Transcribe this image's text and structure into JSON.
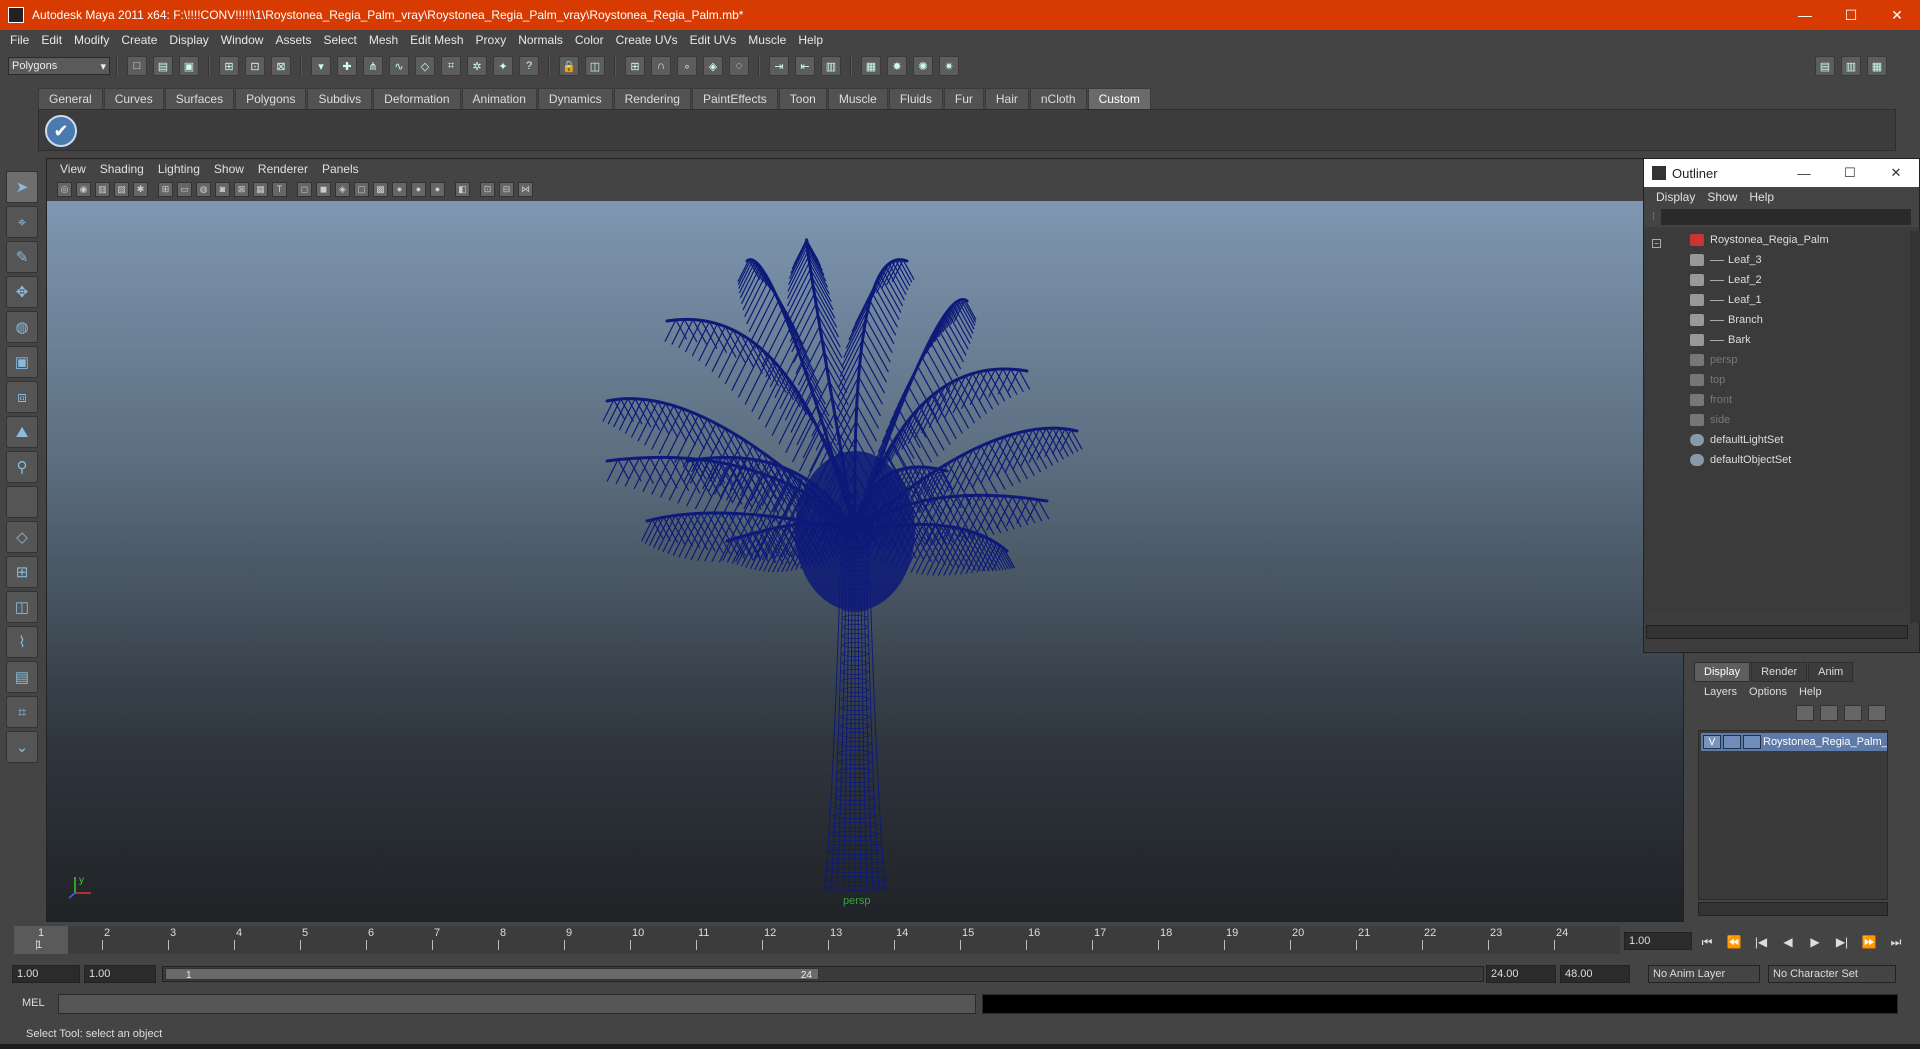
{
  "window": {
    "title": "Autodesk Maya 2011 x64: F:\\!!!!CONV!!!!!\\1\\Roystonea_Regia_Palm_vray\\Roystonea_Regia_Palm_vray\\Roystonea_Regia_Palm.mb*",
    "minimize": "—",
    "maximize": "☐",
    "close": "✕"
  },
  "menu": [
    "File",
    "Edit",
    "Modify",
    "Create",
    "Display",
    "Window",
    "Assets",
    "Select",
    "Mesh",
    "Edit Mesh",
    "Proxy",
    "Normals",
    "Color",
    "Create UVs",
    "Edit UVs",
    "Muscle",
    "Help"
  ],
  "statusline": {
    "mode": "Polygons",
    "mode_arrow": "▾"
  },
  "shelf": {
    "tabs": [
      "General",
      "Curves",
      "Surfaces",
      "Polygons",
      "Subdivs",
      "Deformation",
      "Animation",
      "Dynamics",
      "Rendering",
      "PaintEffects",
      "Toon",
      "Muscle",
      "Fluids",
      "Fur",
      "Hair",
      "nCloth",
      "Custom"
    ],
    "active_tab": "Custom",
    "button_glyph": "✔"
  },
  "viewport": {
    "menu": [
      "View",
      "Shading",
      "Lighting",
      "Show",
      "Renderer",
      "Panels"
    ],
    "camera": "persp",
    "mesh_color": "#0d1a78"
  },
  "outliner": {
    "title": "Outliner",
    "min": "—",
    "max": "☐",
    "close": "✕",
    "menu": [
      "Display",
      "Show",
      "Help"
    ],
    "root": "Roystonea_Regia_Palm",
    "children": [
      "Leaf_3",
      "Leaf_2",
      "Leaf_1",
      "Branch",
      "Bark"
    ],
    "cameras": [
      "persp",
      "top",
      "front",
      "side"
    ],
    "sets": [
      "defaultLightSet",
      "defaultObjectSet"
    ]
  },
  "layers": {
    "tabs": [
      "Display",
      "Render",
      "Anim"
    ],
    "active_tab": "Display",
    "menu": [
      "Layers",
      "Options",
      "Help"
    ],
    "layer_visible": "V",
    "layer_name": "Roystonea_Regia_Palm_l"
  },
  "timeline": {
    "ticks": [
      "1",
      "2",
      "3",
      "4",
      "5",
      "6",
      "7",
      "8",
      "9",
      "10",
      "11",
      "12",
      "13",
      "14",
      "15",
      "16",
      "17",
      "18",
      "19",
      "20",
      "21",
      "22",
      "23",
      "24"
    ],
    "current_frame": "1.00",
    "current_marker": "1",
    "playback_glyphs": [
      "⏮",
      "⏪",
      "|◀",
      "◀",
      "▶",
      "▶|",
      "⏩",
      "⏭"
    ]
  },
  "range": {
    "start_time": "1.00",
    "playback_start": "1.00",
    "range_start": "1",
    "range_end": "24",
    "playback_end": "24.00",
    "end_time": "48.00",
    "anim_layer": "No Anim Layer",
    "char_set": "No Character Set"
  },
  "commandline": {
    "label": "MEL"
  },
  "helpline": {
    "text": "Select Tool: select an object"
  }
}
